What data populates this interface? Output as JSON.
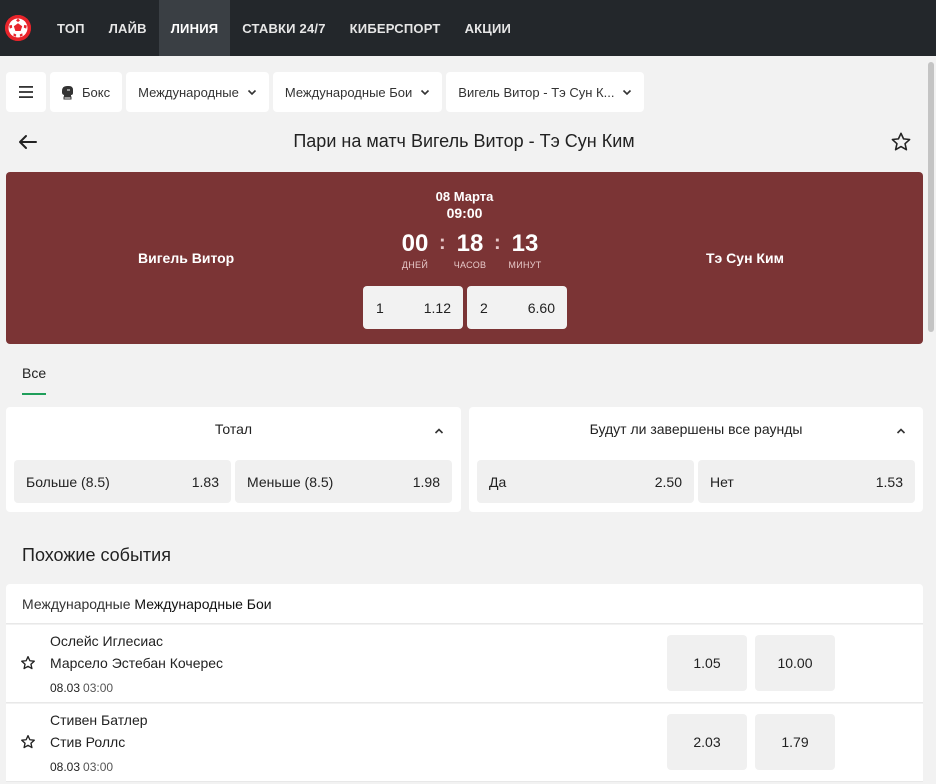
{
  "nav": {
    "items": [
      {
        "label": "ТОП"
      },
      {
        "label": "ЛАЙВ"
      },
      {
        "label": "ЛИНИЯ"
      },
      {
        "label": "СТАВКИ 24/7"
      },
      {
        "label": "КИБЕРСПОРТ"
      },
      {
        "label": "АКЦИИ"
      }
    ],
    "active_index": 2
  },
  "breadcrumbs": {
    "sport": "Бокс",
    "category": "Международные",
    "tournament": "Международные Бои",
    "event": "Вигель Витор - Тэ Сун К..."
  },
  "page": {
    "title": "Пари на матч Вигель Витор - Тэ Сун Ким"
  },
  "event": {
    "home": "Вигель Витор",
    "away": "Тэ Сун Ким",
    "date": "08 Марта",
    "time": "09:00",
    "countdown": {
      "days": "00",
      "days_label": "ДНЕЙ",
      "hours": "18",
      "hours_label": "ЧАСОВ",
      "minutes": "13",
      "minutes_label": "МИНУТ",
      "separator": ":"
    },
    "odds": [
      {
        "outcome": "1",
        "value": "1.12"
      },
      {
        "outcome": "2",
        "value": "6.60"
      }
    ]
  },
  "tabs": [
    {
      "label": "Все",
      "active": true
    }
  ],
  "markets": [
    {
      "title": "Тотал",
      "options": [
        {
          "label": "Больше (8.5)",
          "value": "1.83"
        },
        {
          "label": "Меньше (8.5)",
          "value": "1.98"
        }
      ]
    },
    {
      "title": "Будут ли завершены все раунды",
      "options": [
        {
          "label": "Да",
          "value": "2.50"
        },
        {
          "label": "Нет",
          "value": "1.53"
        }
      ]
    }
  ],
  "similar": {
    "heading": "Похожие события",
    "league_category": "Международные",
    "league_name": "Международные Бои",
    "events": [
      {
        "p1": "Ослейс Иглесиас",
        "p2": "Марсело Эстебан Кочерес",
        "date": "08.03",
        "time": "03:00",
        "o1": "1.05",
        "o2": "10.00"
      },
      {
        "p1": "Стивен Батлер",
        "p2": "Стив Роллс",
        "date": "08.03",
        "time": "03:00",
        "o1": "2.03",
        "o2": "1.79"
      }
    ]
  },
  "colors": {
    "nav_bg": "#23272b",
    "banner_bg": "#7b3435",
    "accent_green": "#1f9e5a",
    "logo_red": "#e8242b"
  },
  "icons": {
    "logo": "soccer-ball-logo",
    "menu": "hamburger-icon",
    "sport": "boxing-glove-icon",
    "back": "arrow-left-icon",
    "favorite": "star-outline-icon"
  }
}
